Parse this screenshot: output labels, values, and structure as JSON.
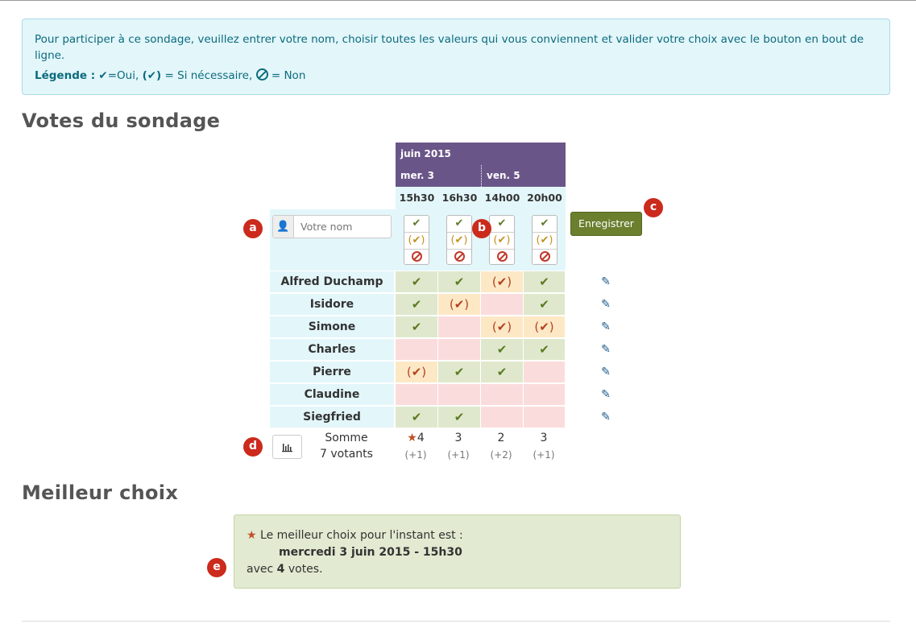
{
  "info": {
    "text": "Pour participer à ce sondage, veuillez entrer votre nom, choisir toutes les valeurs qui vous conviennent et valider votre choix avec le bouton en bout de ligne.",
    "legend_label": "Légende :",
    "legend_yes": "=Oui,",
    "legend_ifneed": "= Si nécessaire,",
    "legend_no": "= Non"
  },
  "headings": {
    "votes": "Votes du sondage",
    "best": "Meilleur choix"
  },
  "table": {
    "month": "juin 2015",
    "days": [
      {
        "label": "mer. 3"
      },
      {
        "label": "ven. 5"
      }
    ],
    "times": [
      "15h30",
      "16h30",
      "14h00",
      "20h00"
    ],
    "name_placeholder": "Votre nom",
    "save_label": "Enregistrer",
    "rows": [
      {
        "name": "Alfred Duchamp",
        "votes": [
          "yes",
          "yes",
          "ifneed",
          "yes"
        ]
      },
      {
        "name": "Isidore",
        "votes": [
          "yes",
          "ifneed",
          "no",
          "yes"
        ]
      },
      {
        "name": "Simone",
        "votes": [
          "yes",
          "no",
          "ifneed",
          "ifneed"
        ]
      },
      {
        "name": "Charles",
        "votes": [
          "no",
          "no",
          "yes",
          "yes"
        ]
      },
      {
        "name": "Pierre",
        "votes": [
          "ifneed",
          "yes",
          "yes",
          "no"
        ]
      },
      {
        "name": "Claudine",
        "votes": [
          "no",
          "no",
          "no",
          "no"
        ]
      },
      {
        "name": "Siegfried",
        "votes": [
          "yes",
          "yes",
          "no",
          "no"
        ]
      }
    ],
    "sum_label": "Somme",
    "voters_label": "7 votants",
    "sums": [
      "4",
      "3",
      "2",
      "3"
    ],
    "sums_ifneed": [
      "(+1)",
      "(+1)",
      "(+2)",
      "(+1)"
    ]
  },
  "badges": [
    "a",
    "b",
    "c",
    "d",
    "e"
  ],
  "best": {
    "intro": "Le meilleur choix pour l'instant est :",
    "choice": "mercredi 3 juin 2015 - 15h30",
    "avec": "avec",
    "count": "4",
    "votes_word": "votes."
  },
  "colors": {
    "header_purple": "#6a5588",
    "yes_bg": "#dfe8cc",
    "ifneed_bg": "#fde8c6",
    "no_bg": "#fbdcdc",
    "badge_red": "#cc2a1c",
    "save_green": "#6b7f2e"
  },
  "icons": {
    "yes": "check-icon",
    "ifneed": "check-in-parens-icon",
    "no": "ban-icon",
    "edit": "pencil-icon",
    "user": "user-icon",
    "chart": "bar-chart-icon",
    "star": "star-icon"
  }
}
